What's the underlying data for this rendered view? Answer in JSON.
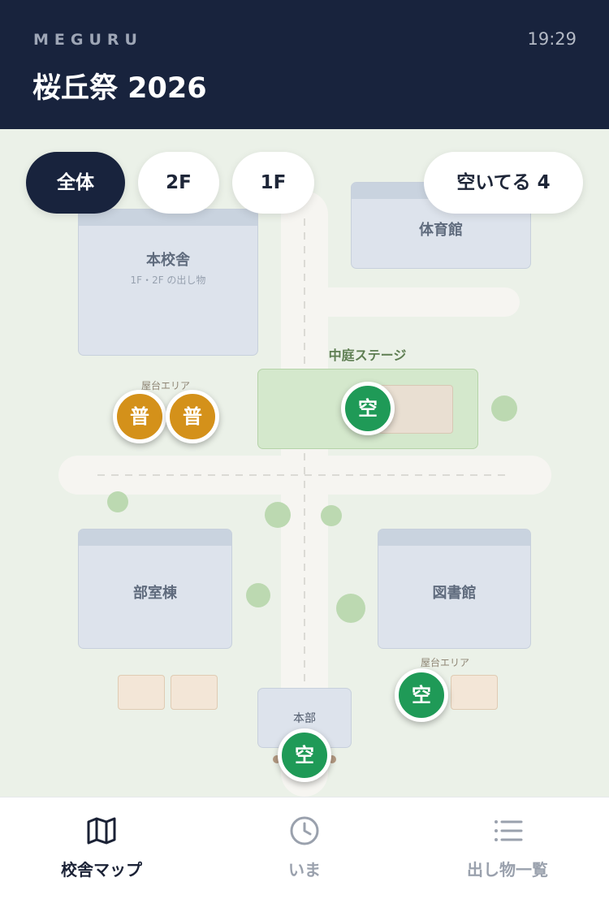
{
  "header": {
    "brand": "MEGURU",
    "time": "19:29",
    "title": "桜丘祭 2026"
  },
  "filters": {
    "all": "全体",
    "floor2": "2F",
    "floor1": "1F",
    "available": "空いてる 4"
  },
  "map": {
    "buildings": {
      "main": {
        "name": "本校舎",
        "sub": "1F・2F の出し物"
      },
      "gym": {
        "name": "体育館"
      },
      "club": {
        "name": "部室棟"
      },
      "library": {
        "name": "図書館"
      },
      "hq": {
        "name": "本部"
      }
    },
    "stage_label": "中庭ステージ",
    "stall_area_label_top": "屋台エリア",
    "stall_area_label_bottom": "屋台エリア",
    "pins": {
      "stall1": "普",
      "stall2": "普",
      "stage": "空",
      "library_stall": "空",
      "hq": "空"
    },
    "status_colors": {
      "available": "#1f9a57",
      "normal": "#d4911a"
    }
  },
  "nav": {
    "map": "校舎マップ",
    "now": "いま",
    "list": "出し物一覧"
  },
  "icons": {
    "map": "map-icon",
    "now": "clock-icon",
    "list": "list-icon"
  }
}
